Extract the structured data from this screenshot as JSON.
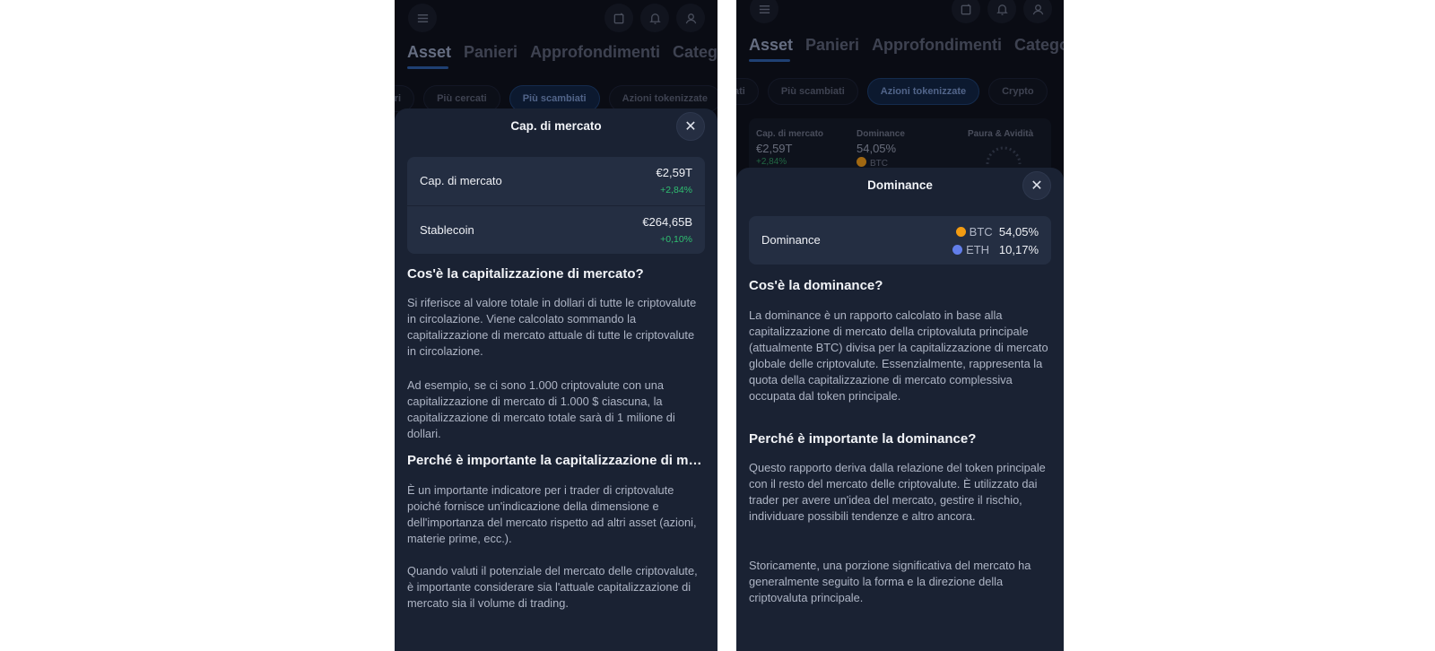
{
  "header": {
    "tabs": [
      "Asset",
      "Panieri",
      "Approfondimenti",
      "Categorie"
    ],
    "icons": {
      "menu": "menu-icon",
      "edit": "edit-icon",
      "notifications": "bell-icon",
      "profile": "user-icon"
    }
  },
  "left": {
    "chips": [
      "ori",
      "Più cercati",
      "Più scambiati",
      "Azioni tokenizzate"
    ],
    "sheet": {
      "title": "Cap. di mercato",
      "rows": [
        {
          "label": "Cap. di mercato",
          "value": "€2,59T",
          "change": "+2,84%"
        },
        {
          "label": "Stablecoin",
          "value": "€264,65B",
          "change": "+0,10%"
        }
      ],
      "heading1": "Cos'è la capitalizzazione di mercato?",
      "p1": "Si riferisce al valore totale in dollari di tutte le criptovalute in circolazione. Viene calcolato sommando la capitalizzazione di mercato attuale di tutte le criptovalute in circolazione.",
      "p2": "Ad esempio, se ci sono 1.000 criptovalute con una capitalizzazione di mercato di 1.000 $ ciascuna, la capitalizzazione di mercato totale sarà di 1 milione di dollari.",
      "heading2": "Perché è importante la capitalizzazione di mercato?",
      "p3": "È un importante indicatore per i trader di criptovalute poiché fornisce un'indicazione della dimensione e dell'importanza del mercato rispetto ad altri asset (azioni, materie prime, ecc.).",
      "p4": "Quando valuti il potenziale del mercato delle criptovalute, è importante considerare sia l'attuale capitalizzazione di mercato sia il volume di trading."
    }
  },
  "right": {
    "chips": [
      "ati",
      "Più scambiati",
      "Azioni tokenizzate",
      "Crypto"
    ],
    "stats": {
      "cap_label": "Cap. di mercato",
      "cap_value": "€2,59T",
      "cap_change": "+2,84%",
      "dom_label": "Dominance",
      "dom_value": "54,05%",
      "dom_coin": "BTC",
      "fear_label": "Paura & Avidità"
    },
    "sheet": {
      "title": "Dominance",
      "row_label": "Dominance",
      "btc_label": "BTC",
      "btc_value": "54,05%",
      "eth_label": "ETH",
      "eth_value": "10,17%",
      "heading1": "Cos'è la dominance?",
      "p1": "La dominance è un rapporto calcolato in base alla capitalizzazione di mercato della criptovaluta principale (attualmente BTC) divisa per la capitalizzazione di mercato globale delle criptovalute. Essenzialmente, rappresenta la quota della capitalizzazione di mercato complessiva occupata dal token principale.",
      "heading2": "Perché è importante la dominance?",
      "p2": "Questo rapporto deriva dalla relazione del token principale con il resto del mercato delle criptovalute. È utilizzato dai trader per avere un'idea del mercato, gestire il rischio, individuare possibili tendenze e altro ancora.",
      "p3": "Storicamente, una porzione significativa del mercato ha generalmente seguito la forma e la direzione della criptovaluta principale."
    }
  },
  "colors": {
    "background": "#0b0e16",
    "sheet": "#1a2233",
    "card": "#242e42",
    "positive": "#2fbf71",
    "btc": "#f39c12",
    "eth": "#627eea"
  }
}
